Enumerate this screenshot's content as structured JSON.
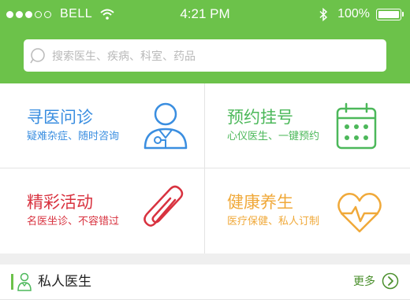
{
  "status_bar": {
    "carrier": "BELL",
    "time": "4:21 PM",
    "battery": "100%",
    "signal_bars_filled": 3,
    "signal_bars_total": 5
  },
  "search": {
    "placeholder": "搜索医生、疾病、科室、药品"
  },
  "tiles": [
    {
      "title": "寻医问诊",
      "subtitle": "疑难杂症、随时咨询",
      "color": "#3a8ee0",
      "icon": "doctor-icon"
    },
    {
      "title": "预约挂号",
      "subtitle": "心仪医生、一键预约",
      "color": "#4cb85a",
      "icon": "calendar-icon"
    },
    {
      "title": "精彩活动",
      "subtitle": "名医坐诊、不容错过",
      "color": "#d8323f",
      "icon": "paperclip-icon"
    },
    {
      "title": "健康养生",
      "subtitle": "医疗保健、私人订制",
      "color": "#f0a93a",
      "icon": "heart-pulse-icon"
    }
  ],
  "section": {
    "title": "私人医生",
    "more_label": "更多",
    "icon": "doctor-small-icon"
  },
  "colors": {
    "header": "#6cc24a",
    "accent": "#4a8f2c"
  }
}
